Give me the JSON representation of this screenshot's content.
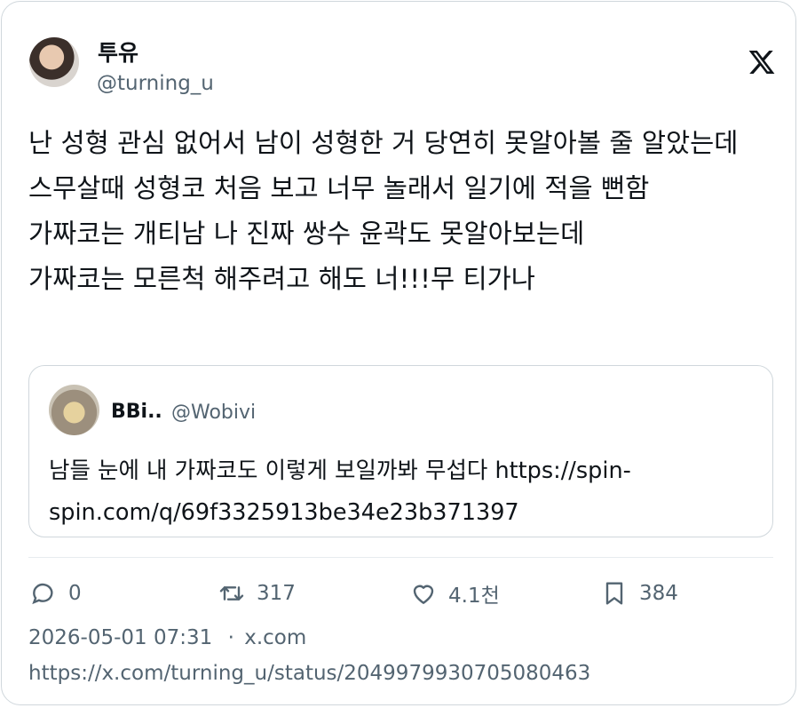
{
  "author": {
    "display_name": "투유",
    "handle": "@turning_u"
  },
  "tweet": {
    "text": "난 성형 관심 없어서 남이 성형한 거 당연히 못알아볼 줄 알았는데\n스무살때 성형코 처음 보고 너무 놀래서 일기에 적을 뻔함\n가짜코는 개티남 나 진짜 쌍수 윤곽도 못알아보는데\n가짜코는 모른척 해주려고 해도 너!!!무 티가나"
  },
  "quote": {
    "display_name": "BBi..",
    "handle": "@Wobivi",
    "text": "남들 눈에 내 가짜코도 이렇게 보일까봐 무섭다  https://spin-spin.com/q/69f3325913be34e23b371397"
  },
  "actions": {
    "replies": "0",
    "retweets": "317",
    "likes": "4.1천",
    "bookmarks": "384"
  },
  "meta": {
    "timestamp": "2026-05-01 07:31",
    "separator": "·",
    "source": "x.com",
    "url": "https://x.com/turning_u/status/2049979930705080463"
  },
  "icons": {
    "brand": "x-logo-icon",
    "reply": "speech-bubble-icon",
    "retweet": "retweet-icon",
    "like": "heart-icon",
    "bookmark": "bookmark-icon"
  },
  "colors": {
    "text": "#0f1419",
    "secondary": "#536471",
    "border": "#d0d7dc"
  }
}
